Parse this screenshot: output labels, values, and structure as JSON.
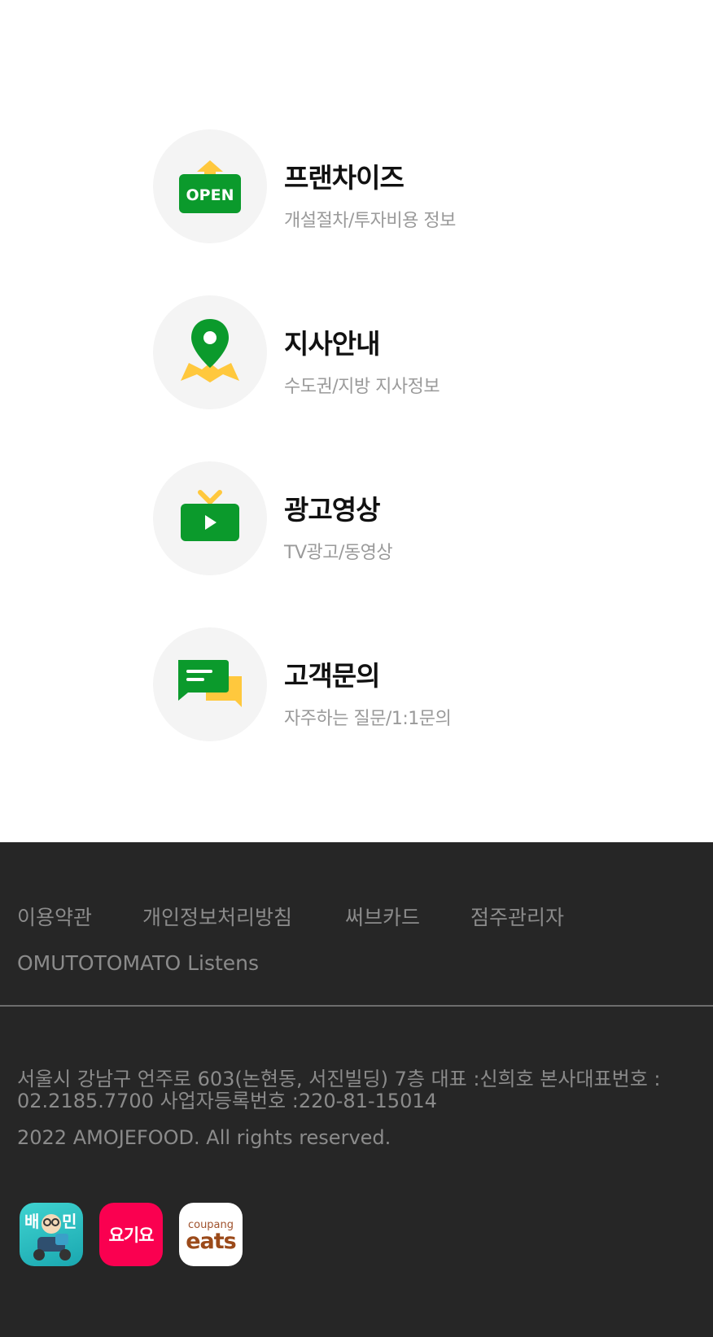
{
  "menu": {
    "items": [
      {
        "title": "프랜차이즈",
        "subtitle": "개설절차/투자비용 정보",
        "icon": "open-sign-icon"
      },
      {
        "title": "지사안내",
        "subtitle": "수도권/지방 지사정보",
        "icon": "map-pin-icon"
      },
      {
        "title": "광고영상",
        "subtitle": "TV광고/동영상",
        "icon": "tv-play-icon"
      },
      {
        "title": "고객문의",
        "subtitle": "자주하는 질문/1:1문의",
        "icon": "chat-bubbles-icon"
      }
    ],
    "open_sign_text": "OPEN"
  },
  "footer": {
    "links": [
      "이용약관",
      "개인정보처리방침",
      "써브카드",
      "점주관리자",
      "OMUTOTOMATO Listens"
    ],
    "address": "서울시 강남구 언주로 603(논현동, 서진빌딩) 7층 대표 :신희호 본사대표번호 : 02.2185.7700 사업자등록번호 :220-81-15014",
    "copyright": "2022 AMOJEFOOD. All rights reserved.",
    "apps": [
      {
        "name": "배민",
        "icon": "baemin-app-icon"
      },
      {
        "name": "요기요",
        "icon": "yogiyo-app-icon"
      },
      {
        "name_top": "coupang",
        "name_bottom": "eats",
        "icon": "coupang-eats-app-icon"
      }
    ]
  },
  "colors": {
    "brand_green": "#0b9a2c",
    "brand_yellow": "#ffc83d",
    "footer_bg": "#262626",
    "footer_text": "#8b8b8b"
  }
}
